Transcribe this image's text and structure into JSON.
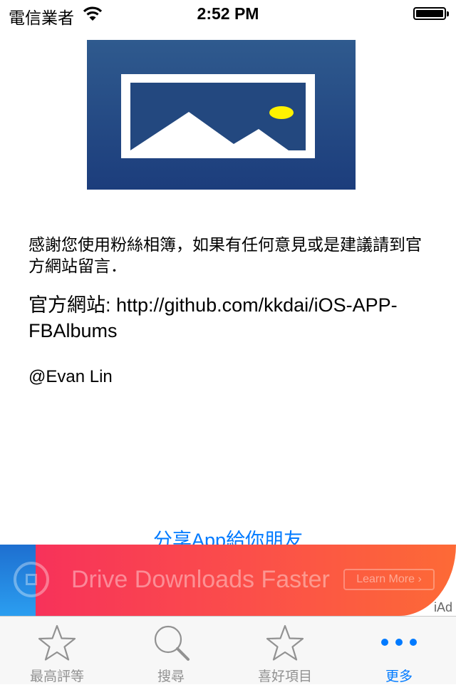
{
  "status_bar": {
    "carrier": "電信業者",
    "time": "2:52 PM"
  },
  "content": {
    "thanks_text": "感謝您使用粉絲相簿，如果有任何意見或是建議請到官方網站留言．",
    "website_text": "官方網站: http://github.com/kkdai/iOS-APP-FBAlbums",
    "author": "@Evan Lin",
    "share_link": "分享App給你朋友"
  },
  "ad": {
    "headline": "Drive Downloads Faster",
    "cta": "Learn More",
    "badge": "iAd"
  },
  "tabs": [
    {
      "label": "最高評等",
      "icon": "star-icon",
      "active": false
    },
    {
      "label": "搜尋",
      "icon": "search-icon",
      "active": false
    },
    {
      "label": "喜好項目",
      "icon": "star-icon",
      "active": false
    },
    {
      "label": "更多",
      "icon": "more-icon",
      "active": true
    }
  ],
  "colors": {
    "accent": "#007aff",
    "logo_bg": "#2a5288",
    "ad_red": "#f7325a",
    "ad_orange": "#fd6a36"
  }
}
